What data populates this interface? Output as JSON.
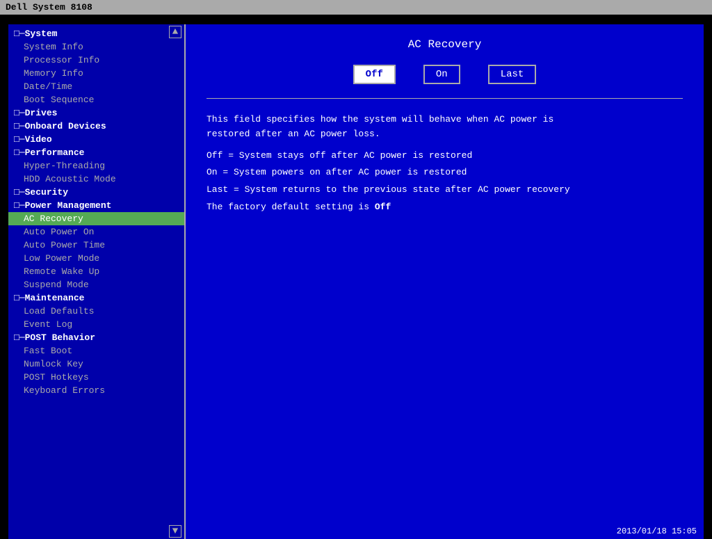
{
  "bios": {
    "title": "Dell System 8108",
    "timestamp": "2013/01/18 15:05"
  },
  "sidebar": {
    "scroll_up": "▲",
    "scroll_down": "▼",
    "items": [
      {
        "id": "system",
        "label": "System",
        "type": "section",
        "prefix": "□─"
      },
      {
        "id": "system-info",
        "label": "System Info",
        "type": "sub"
      },
      {
        "id": "processor-info",
        "label": "Processor Info",
        "type": "sub"
      },
      {
        "id": "memory-info",
        "label": "Memory Info",
        "type": "sub"
      },
      {
        "id": "date-time",
        "label": "Date/Time",
        "type": "sub"
      },
      {
        "id": "boot-sequence",
        "label": "Boot Sequence",
        "type": "sub"
      },
      {
        "id": "drives",
        "label": "Drives",
        "type": "section",
        "prefix": "□─"
      },
      {
        "id": "onboard-devices",
        "label": "Onboard Devices",
        "type": "section",
        "prefix": "□─"
      },
      {
        "id": "video",
        "label": "Video",
        "type": "section",
        "prefix": "□─"
      },
      {
        "id": "performance",
        "label": "Performance",
        "type": "section",
        "prefix": "□─"
      },
      {
        "id": "hyper-threading",
        "label": "Hyper-Threading",
        "type": "sub"
      },
      {
        "id": "hdd-acoustic",
        "label": "HDD Acoustic Mode",
        "type": "sub"
      },
      {
        "id": "security",
        "label": "Security",
        "type": "section",
        "prefix": "□─"
      },
      {
        "id": "power-management",
        "label": "Power Management",
        "type": "section",
        "prefix": "□─"
      },
      {
        "id": "ac-recovery",
        "label": "AC Recovery",
        "type": "sub",
        "active": true
      },
      {
        "id": "auto-power-on",
        "label": "Auto Power On",
        "type": "sub"
      },
      {
        "id": "auto-power-time",
        "label": "Auto Power Time",
        "type": "sub"
      },
      {
        "id": "low-power-mode",
        "label": "Low Power Mode",
        "type": "sub"
      },
      {
        "id": "remote-wake-up",
        "label": "Remote Wake Up",
        "type": "sub"
      },
      {
        "id": "suspend-mode",
        "label": "Suspend Mode",
        "type": "sub"
      },
      {
        "id": "maintenance",
        "label": "Maintenance",
        "type": "section",
        "prefix": "□─"
      },
      {
        "id": "load-defaults",
        "label": "Load Defaults",
        "type": "sub"
      },
      {
        "id": "event-log",
        "label": "Event Log",
        "type": "sub"
      },
      {
        "id": "post-behavior",
        "label": "POST Behavior",
        "type": "section",
        "prefix": "□─"
      },
      {
        "id": "fast-boot",
        "label": "Fast Boot",
        "type": "sub"
      },
      {
        "id": "numlock-key",
        "label": "Numlock Key",
        "type": "sub"
      },
      {
        "id": "post-hotkeys",
        "label": "POST Hotkeys",
        "type": "sub"
      },
      {
        "id": "keyboard-errors",
        "label": "Keyboard Errors",
        "type": "sub"
      }
    ]
  },
  "panel": {
    "title": "AC Recovery",
    "options": [
      {
        "id": "off",
        "label": "Off",
        "selected": true
      },
      {
        "id": "on",
        "label": "On",
        "selected": false
      },
      {
        "id": "last",
        "label": "Last",
        "selected": false
      }
    ],
    "description_line1": "This field specifies how the system will behave when AC power is",
    "description_line2": "restored after an AC power loss.",
    "option_off": "Off  = System stays off after AC power is restored",
    "option_on": "On   = System powers on after AC power is restored",
    "option_last": "Last = System returns to the previous state after AC power recovery",
    "factory_default_prefix": "The factory default setting is ",
    "factory_default_value": "Off"
  }
}
